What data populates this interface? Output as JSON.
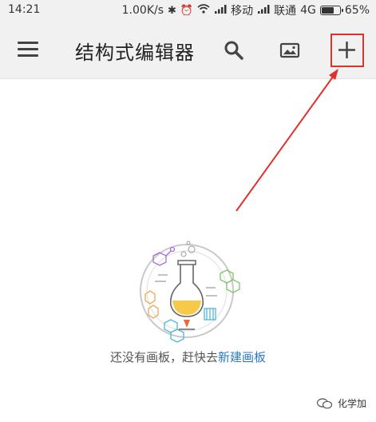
{
  "status_bar": {
    "time": "14:21",
    "speed": "1.00K/s",
    "carrier1": "移动",
    "carrier2": "联通",
    "network": "4G",
    "battery": "65%",
    "battery_level": 0.65
  },
  "toolbar": {
    "title": "结构式编辑器",
    "icons": [
      "menu-icon",
      "search-icon",
      "image-icon",
      "add-icon"
    ]
  },
  "empty_state": {
    "message": "还没有画板，赶快去",
    "link": "新建画板"
  },
  "watermark": {
    "text": "化学加"
  },
  "colors": {
    "toolbar_bg": "#f1f1f1",
    "annotation_red": "#e0302c",
    "link_blue": "#2b78c6"
  }
}
